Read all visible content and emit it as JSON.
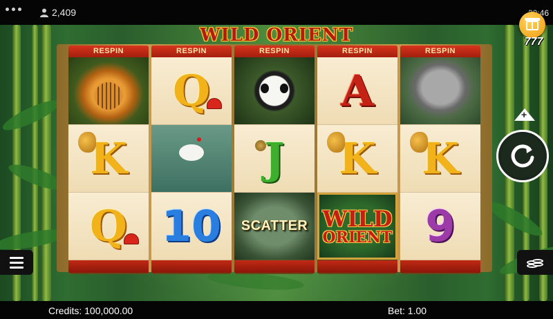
{
  "status_bar": {
    "players_count": "2,409",
    "time": "20:46"
  },
  "game": {
    "title": "WILD ORIENT",
    "badge": "777"
  },
  "reels": [
    {
      "respin_label": "RESPIN",
      "symbols": [
        "tiger",
        "K",
        "Q"
      ]
    },
    {
      "respin_label": "RESPIN",
      "symbols": [
        "Q",
        "crane",
        "10"
      ]
    },
    {
      "respin_label": "RESPIN",
      "symbols": [
        "panda",
        "J",
        "SCATTER"
      ]
    },
    {
      "respin_label": "RESPIN",
      "symbols": [
        "A",
        "K",
        "WILD ORIENT"
      ]
    },
    {
      "respin_label": "RESPIN",
      "symbols": [
        "elephant",
        "K",
        "9"
      ]
    }
  ],
  "symbol_text": {
    "K": "K",
    "Q": "Q",
    "A": "A",
    "J": "J",
    "ten": "10",
    "nine": "9",
    "scatter": "SCATTER",
    "wild_line1": "WILD",
    "wild_line2": "ORIENT"
  },
  "footer": {
    "credits_label": "Credits: 100,000.00",
    "bet_label": "Bet: 1.00"
  },
  "icons": [
    "menu-icon",
    "gift-icon",
    "spin-icon",
    "bet-up-icon",
    "coins-icon",
    "user-icon",
    "more-dots-icon"
  ],
  "colors": {
    "respin_bar": "#c02a14",
    "reel_bg": "#f3e6c8",
    "title_red": "#b31c10",
    "gift_gold": "#f09a12"
  }
}
